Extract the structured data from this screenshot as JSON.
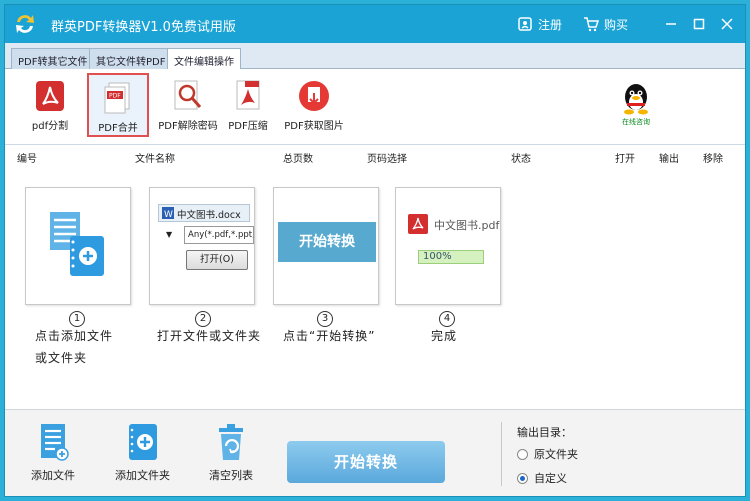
{
  "app": {
    "title": "群英PDF转换器V1.0免费试用版",
    "register_label": "注册",
    "buy_label": "购买"
  },
  "tabs": [
    {
      "label": "PDF转其它文件",
      "active": false
    },
    {
      "label": "其它文件转PDF",
      "active": false
    },
    {
      "label": "文件编辑操作",
      "active": true
    }
  ],
  "toolbar": {
    "items": [
      {
        "label": "pdf分割",
        "icon": "pdf-split-icon"
      },
      {
        "label": "PDF合并",
        "icon": "pdf-merge-icon",
        "selected": true
      },
      {
        "label": "PDF解除密码",
        "icon": "pdf-unlock-icon"
      },
      {
        "label": "PDF压缩",
        "icon": "pdf-compress-icon"
      },
      {
        "label": "PDF获取图片",
        "icon": "pdf-extract-image-icon"
      }
    ],
    "qq_label": "在线咨询"
  },
  "columns": [
    "编号",
    "文件名称",
    "总页数",
    "页码选择",
    "状态",
    "打开",
    "输出",
    "移除"
  ],
  "steps": [
    {
      "num": "1",
      "text_line1": "点击添加文件",
      "text_line2": "或文件夹"
    },
    {
      "num": "2",
      "text_line1": "打开文件或文件夹",
      "file_name": "中文图书.docx",
      "filter": "Any(*.pdf,*.ppt,*",
      "open_button": "打开(O)"
    },
    {
      "num": "3",
      "text_line1": "点击“开始转换”",
      "start_label": "开始转换"
    },
    {
      "num": "4",
      "text_line1": "完成",
      "file_name": "中文图书.pdf",
      "progress": "100%"
    }
  ],
  "bottom": {
    "add_file": "添加文件",
    "add_folder": "添加文件夹",
    "clear_list": "清空列表",
    "start_button": "开始转换",
    "output_dir_label": "输出目录：",
    "options": [
      {
        "label": "原文件夹",
        "selected": false
      },
      {
        "label": "自定义",
        "selected": true
      }
    ]
  },
  "colors": {
    "titlebar": "#1ba3d6",
    "start_button": "#5aa8dc",
    "accent_red": "#d32f2f",
    "selected_outline": "#e05050"
  }
}
